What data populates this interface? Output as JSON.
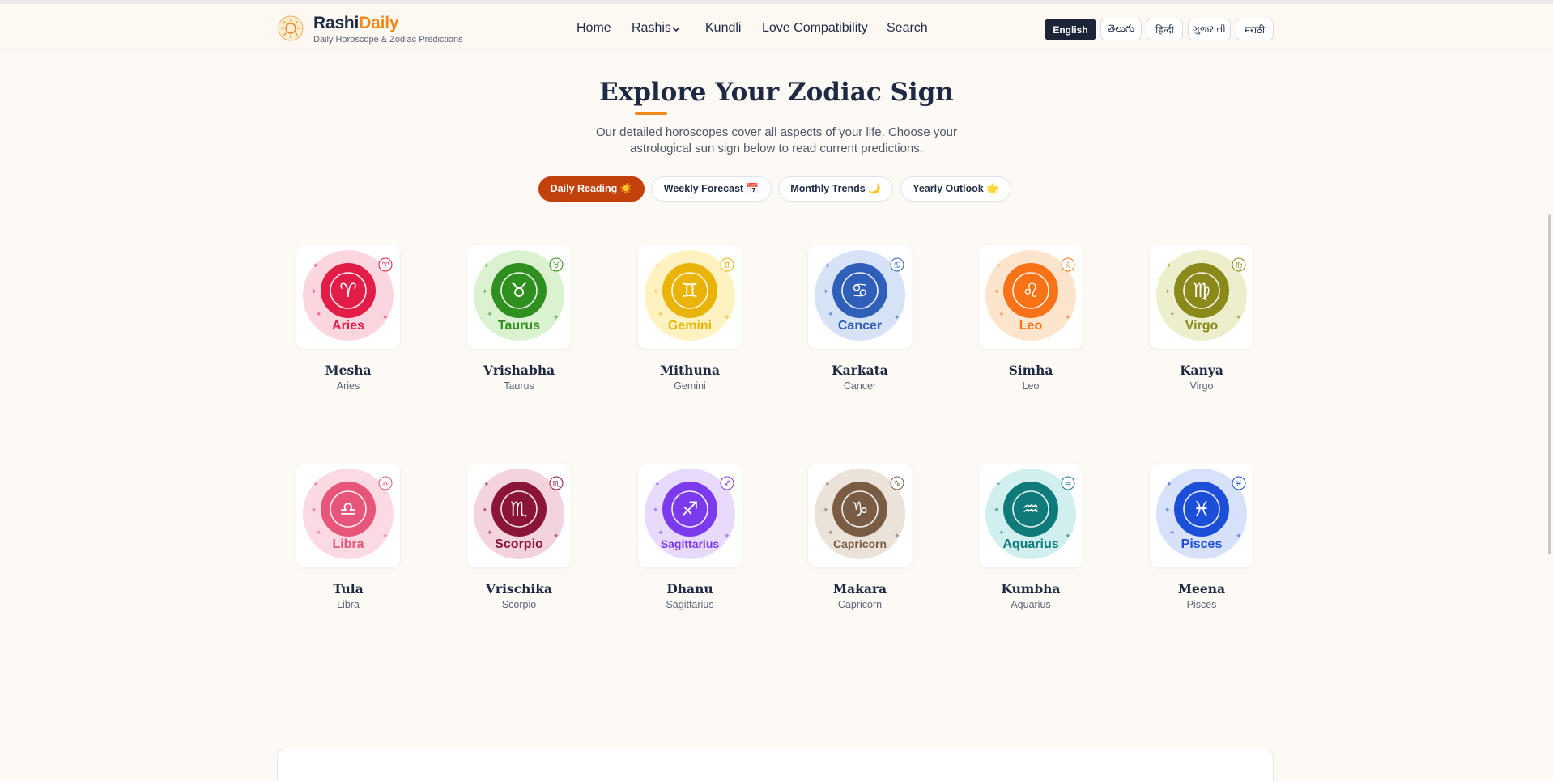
{
  "brand": {
    "name_part1": "Rashi",
    "name_part2": "Daily",
    "tagline": "Daily Horoscope & Zodiac Predictions"
  },
  "nav": [
    {
      "label": "Home"
    },
    {
      "label": "Rashis",
      "has_dropdown": true
    },
    {
      "label": "Kundli"
    },
    {
      "label": "Love Compatibility"
    },
    {
      "label": "Search"
    }
  ],
  "languages": [
    {
      "label": "English",
      "selected": true
    },
    {
      "label": "తెలుగు",
      "selected": false
    },
    {
      "label": "हिन्दी",
      "selected": false
    },
    {
      "label": "ગુજરાતી",
      "selected": false
    },
    {
      "label": "मराठी",
      "selected": false
    }
  ],
  "section": {
    "title": "Explore Your Zodiac Sign",
    "subtitle": "Our detailed horoscopes cover all aspects of your life. Choose your astrological sun sign below to read current predictions."
  },
  "filters": [
    {
      "label": "Daily Reading ☀️",
      "selected": true
    },
    {
      "label": "Weekly Forecast 📅",
      "selected": false
    },
    {
      "label": "Monthly Trends 🌙",
      "selected": false
    },
    {
      "label": "Yearly Outlook 🌟",
      "selected": false
    }
  ],
  "signs": [
    {
      "name": "Mesha",
      "english": "Aries",
      "glyph": "♈",
      "color": "#e11d48",
      "glow": "#fbcfd9",
      "icon": "ram-icon"
    },
    {
      "name": "Vrishabha",
      "english": "Taurus",
      "glyph": "♉",
      "color": "#2f8f1f",
      "glow": "#d4f0c8",
      "icon": "bull-icon"
    },
    {
      "name": "Mithuna",
      "english": "Gemini",
      "glyph": "♊",
      "color": "#eab308",
      "glow": "#fdf0b5",
      "icon": "twins-icon"
    },
    {
      "name": "Karkata",
      "english": "Cancer",
      "glyph": "♋",
      "color": "#2f5fb8",
      "glow": "#cfddf5",
      "icon": "crab-icon"
    },
    {
      "name": "Simha",
      "english": "Leo",
      "glyph": "♌",
      "color": "#f97316",
      "glow": "#fde0c4",
      "icon": "lion-icon"
    },
    {
      "name": "Kanya",
      "english": "Virgo",
      "glyph": "♍",
      "color": "#8a8a1a",
      "glow": "#e9ebc3",
      "icon": "maiden-icon"
    },
    {
      "name": "Tula",
      "english": "Libra",
      "glyph": "♎",
      "color": "#e8557a",
      "glow": "#fbd3de",
      "icon": "scales-icon"
    },
    {
      "name": "Vrischika",
      "english": "Scorpio",
      "glyph": "♏",
      "color": "#8b1538",
      "glow": "#f1cbd6",
      "icon": "scorpion-icon"
    },
    {
      "name": "Dhanu",
      "english": "Sagittarius",
      "glyph": "♐",
      "color": "#7c3aed",
      "glow": "#e4d4fb",
      "icon": "archer-icon"
    },
    {
      "name": "Makara",
      "english": "Capricorn",
      "glyph": "♑",
      "color": "#7a5c45",
      "glow": "#e8ddd2",
      "icon": "sea-goat-icon"
    },
    {
      "name": "Kumbha",
      "english": "Aquarius",
      "glyph": "♒",
      "color": "#0f7a7a",
      "glow": "#c9ecec",
      "icon": "water-bearer-icon"
    },
    {
      "name": "Meena",
      "english": "Pisces",
      "glyph": "♓",
      "color": "#1d4ed8",
      "glow": "#d0dcf8",
      "icon": "fish-icon"
    }
  ]
}
